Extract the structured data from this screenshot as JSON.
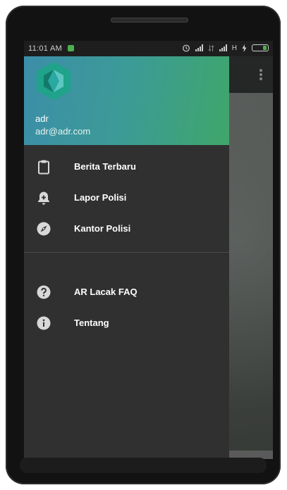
{
  "status_bar": {
    "time": "11:01 AM",
    "network_type": "H"
  },
  "drawer": {
    "header": {
      "user_name": "adr",
      "user_email": "adr@adr.com"
    },
    "primary_items": [
      {
        "label": "Berita Terbaru",
        "icon": "clipboard-icon"
      },
      {
        "label": "Lapor Polisi",
        "icon": "bell-plus-icon"
      },
      {
        "label": "Kantor Polisi",
        "icon": "compass-icon"
      }
    ],
    "secondary_items": [
      {
        "label": "AR Lacak FAQ",
        "icon": "help-circle-icon"
      },
      {
        "label": "Tentang",
        "icon": "info-icon"
      }
    ]
  },
  "colors": {
    "header_gradient_start": "#3c8ea8",
    "header_gradient_end": "#3fa66a",
    "drawer_background": "#303030",
    "logo_color": "#1fa38a"
  }
}
